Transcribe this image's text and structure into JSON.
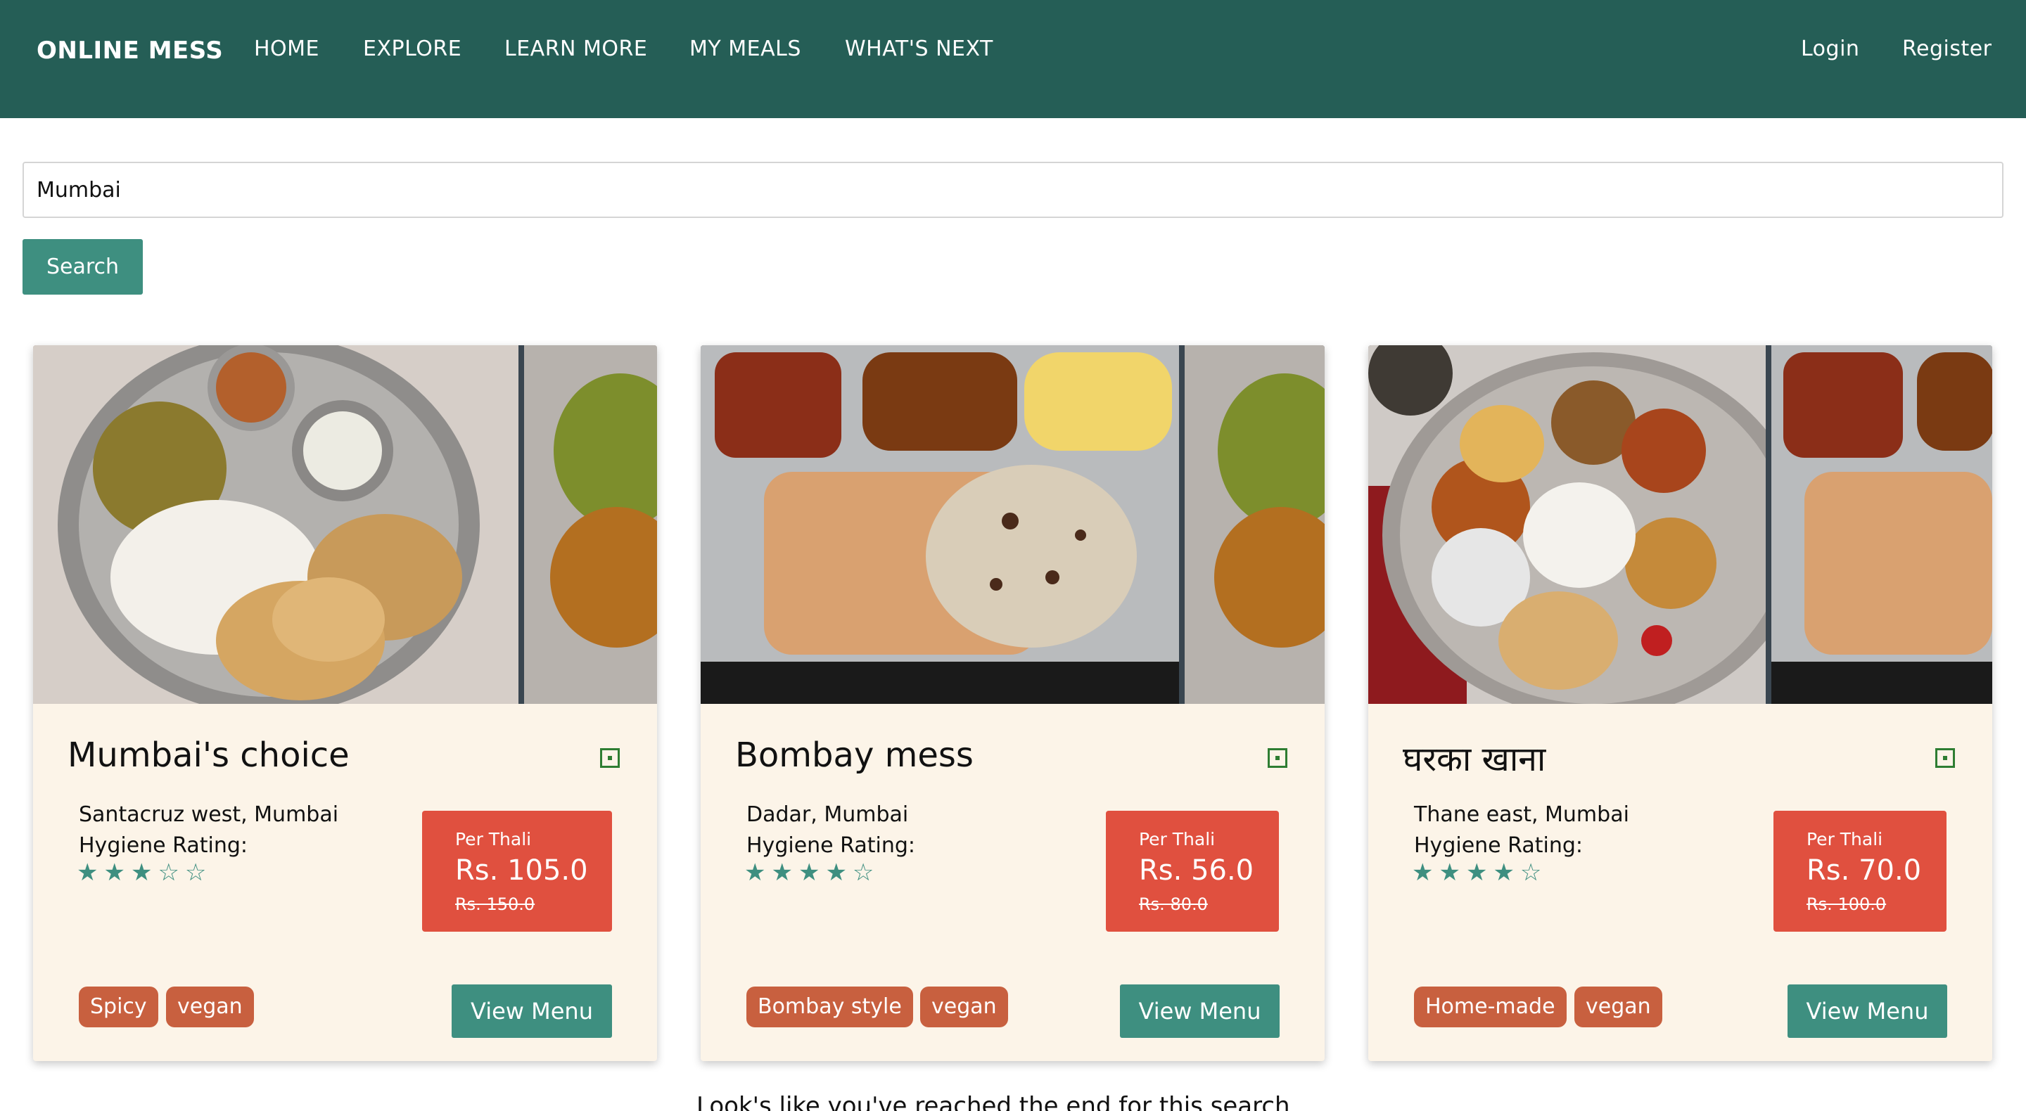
{
  "nav": {
    "brand": "ONLINE MESS",
    "links": [
      "HOME",
      "EXPLORE",
      "LEARN MORE",
      "MY MEALS",
      "WHAT'S NEXT"
    ],
    "login": "Login",
    "register": "Register"
  },
  "search": {
    "value": "Mumbai",
    "button": "Search"
  },
  "cards": [
    {
      "title": "Mumbai's choice",
      "location": "Santacruz west, Mumbai",
      "hygiene_label": "Hygiene Rating:",
      "rating": 3,
      "stars": "★★★☆☆",
      "per": "Per Thali",
      "price": "Rs. 105.0",
      "old_price": "Rs. 150.0",
      "tags": [
        "Spicy",
        "vegan"
      ],
      "button": "View Menu"
    },
    {
      "title": "Bombay mess",
      "location": "Dadar, Mumbai",
      "hygiene_label": "Hygiene Rating:",
      "rating": 4,
      "stars": "★★★★☆",
      "per": "Per Thali",
      "price": "Rs. 56.0",
      "old_price": "Rs. 80.0",
      "tags": [
        "Bombay style",
        "vegan"
      ],
      "button": "View Menu"
    },
    {
      "title": "घरका खाना",
      "location": "Thane east, Mumbai",
      "hygiene_label": "Hygiene Rating:",
      "rating": 4,
      "stars": "★★★★☆",
      "per": "Per Thali",
      "price": "Rs. 70.0",
      "old_price": "Rs. 100.0",
      "tags": [
        "Home-made",
        "vegan"
      ],
      "button": "View Menu"
    }
  ],
  "footer_text": "Look's like you've reached the end for this search",
  "colors": {
    "navbar": "#255e56",
    "accent": "#3e8f80",
    "price_box": "#e0503f",
    "tag": "#c8603f",
    "card_bg": "#fcf4e8",
    "veg_icon": "#2e7d32"
  },
  "icons": {
    "veg": "veg-indicator-icon",
    "rating": "star-icon"
  }
}
